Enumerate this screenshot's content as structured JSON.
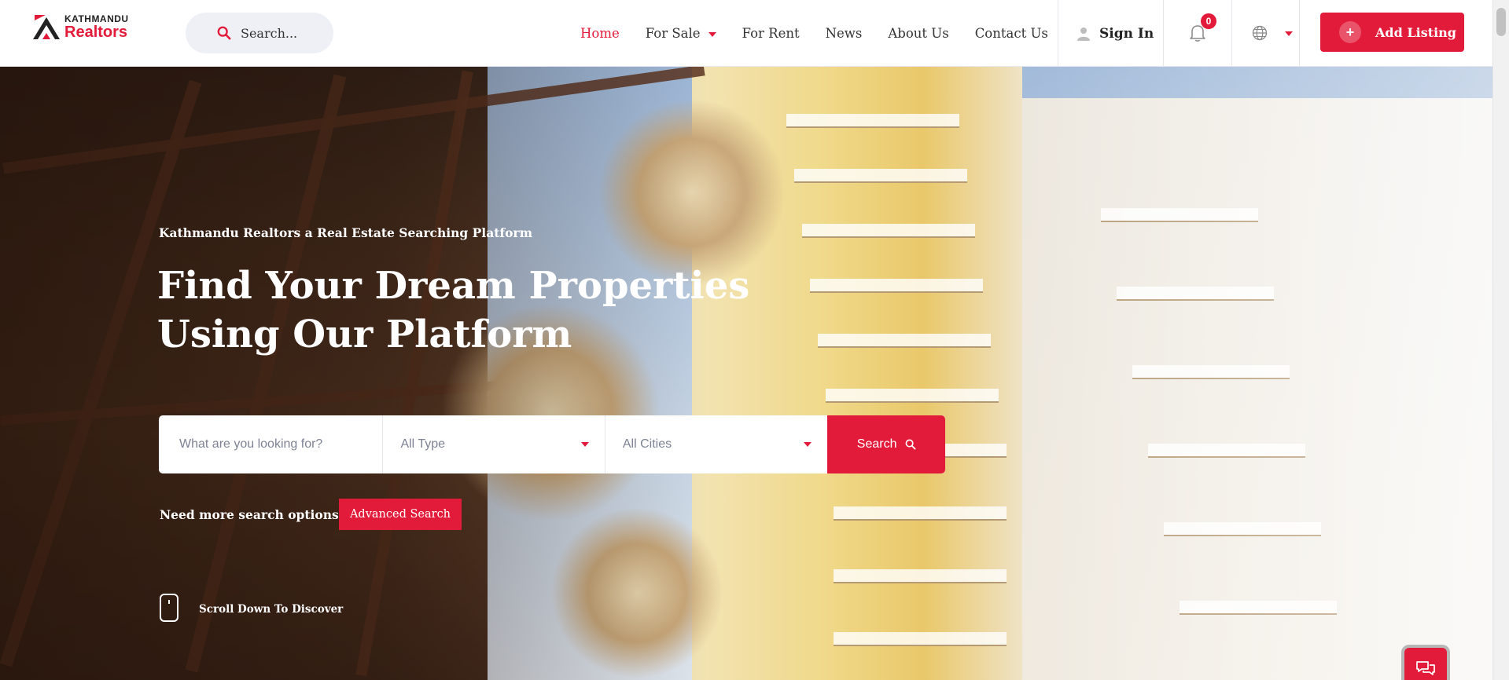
{
  "brand": {
    "name_top": "KATHMANDU",
    "name_bottom": "Realtors",
    "accent_color": "#e31b3a"
  },
  "header": {
    "search_placeholder": "Search...",
    "nav": [
      {
        "label": "Home",
        "active": true
      },
      {
        "label": "For Sale",
        "has_dropdown": true
      },
      {
        "label": "For Rent"
      },
      {
        "label": "News"
      },
      {
        "label": "About Us"
      },
      {
        "label": "Contact Us"
      }
    ],
    "sign_in": "Sign In",
    "notification_count": "0",
    "add_listing": "Add Listing"
  },
  "hero": {
    "subtitle": "Kathmandu Realtors a Real Estate Searching Platform",
    "title_line1": "Find Your Dream Properties",
    "title_line2": "Using Our Platform",
    "search": {
      "keyword_placeholder": "What are you looking for?",
      "type_value": "All Type",
      "city_value": "All Cities",
      "button_label": "Search"
    },
    "more_options_label": "Need more search options?",
    "advanced_button": "Advanced Search",
    "scroll_hint": "Scroll Down To Discover"
  },
  "icons": {
    "search": "search-icon",
    "user": "user-icon",
    "bell": "bell-icon",
    "globe": "globe-icon",
    "plus": "plus-icon",
    "chat": "chat-icon",
    "mouse": "mouse-icon"
  }
}
